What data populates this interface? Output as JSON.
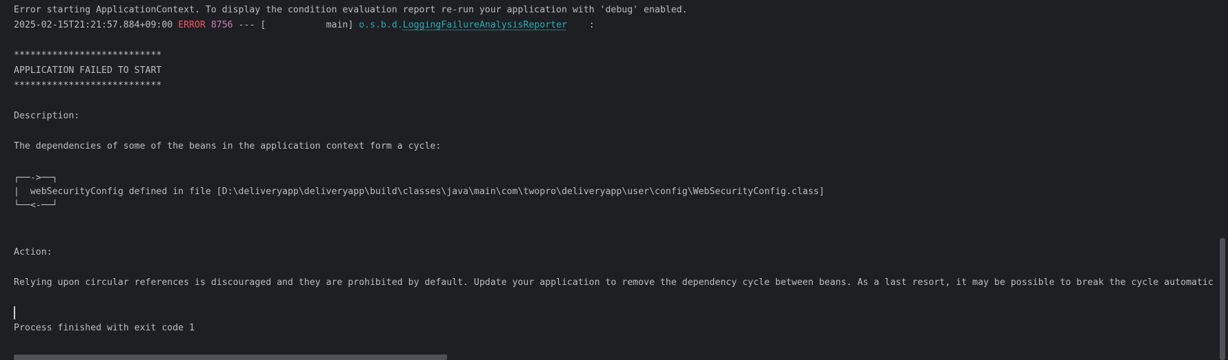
{
  "console": {
    "line1": "Error starting ApplicationContext. To display the condition evaluation report re-run your application with 'debug' enabled.",
    "log_line": {
      "timestamp": "2025-02-15T21:21:57.884+09:00",
      "level": "ERROR",
      "pid": "8756",
      "separator": "--- [           main]",
      "logger_prefix": "o.s.b.d.",
      "logger_name": "LoggingFailureAnalysisReporter",
      "colon": ":"
    },
    "stars_top": "***************************",
    "banner": "APPLICATION FAILED TO START",
    "stars_bottom": "***************************",
    "description_label": "Description:",
    "description_text": "The dependencies of some of the beans in the application context form a cycle:",
    "cycle_top": "┌──->──┐",
    "cycle_middle": "|  webSecurityConfig defined in file [D:\\deliveryapp\\deliveryapp\\build\\classes\\java\\main\\com\\twopro\\deliveryapp\\user\\config\\WebSecurityConfig.class]",
    "cycle_bottom": "└──<-──┘",
    "action_label": "Action:",
    "action_text": "Relying upon circular references is discouraged and they are prohibited by default. Update your application to remove the dependency cycle between beans. As a last resort, it may be possible to break the cycle automatic",
    "exit_text": "Process finished with exit code 1"
  },
  "colors": {
    "background": "#1e1f22",
    "text": "#bcbec4",
    "error": "#f75464",
    "pid": "#c77dbb",
    "logger": "#2aacb8"
  }
}
